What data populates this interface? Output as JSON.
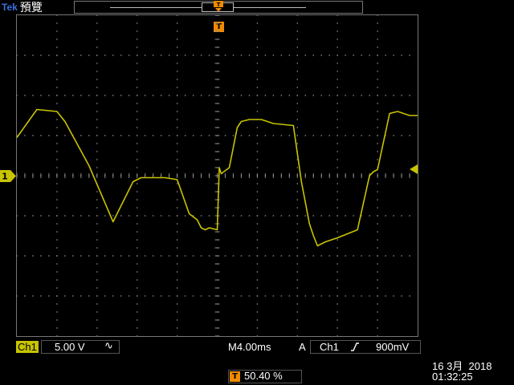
{
  "header": {
    "brand": "Tek",
    "mode": "預覽"
  },
  "trigger": {
    "position_marker": "T",
    "position_percent_label": "50.40 %",
    "mode": "A",
    "source": "Ch1",
    "slope_icon": "rising-edge-icon",
    "level": "900mV"
  },
  "channel": {
    "label": "Ch1",
    "marker": "1",
    "scale": "5.00 V",
    "coupling_icon": "∿"
  },
  "timebase": "M4.00ms",
  "datetime": {
    "date": "16 3月  2018",
    "time": "01:32:25"
  },
  "colors": {
    "trace": "#c8c400",
    "trigger": "#f08a00",
    "brand": "#3a6fe0"
  },
  "chart_data": {
    "type": "line",
    "divisions": {
      "x": 10,
      "y": 8
    },
    "y_unit_per_div": "5.00 V",
    "x_unit_per_div": "4.00ms",
    "series": [
      {
        "x": [
          0.0,
          0.5,
          1.0,
          1.2,
          1.8,
          2.4,
          2.9,
          3.1,
          3.3,
          3.5,
          3.7,
          4.0,
          4.3,
          4.5,
          4.6,
          4.7,
          4.8,
          5.0,
          5.05,
          5.1,
          5.3,
          5.5,
          5.6,
          5.8,
          6.1,
          6.4,
          6.9,
          7.1,
          7.3,
          7.4,
          7.5,
          7.7,
          8.0,
          8.5,
          8.8,
          8.9,
          9.0,
          9.3,
          9.5,
          9.8,
          10.0
        ],
        "y": [
          0.95,
          1.65,
          1.6,
          1.35,
          0.25,
          -1.15,
          -0.15,
          -0.05,
          -0.05,
          -0.05,
          -0.05,
          -0.1,
          -0.95,
          -1.1,
          -1.3,
          -1.35,
          -1.3,
          -1.35,
          0.2,
          0.05,
          0.2,
          1.2,
          1.35,
          1.4,
          1.4,
          1.3,
          1.25,
          -0.15,
          -1.2,
          -1.5,
          -1.75,
          -1.65,
          -1.55,
          -1.35,
          0.0,
          0.1,
          0.15,
          1.55,
          1.6,
          1.5,
          1.5
        ]
      }
    ]
  }
}
